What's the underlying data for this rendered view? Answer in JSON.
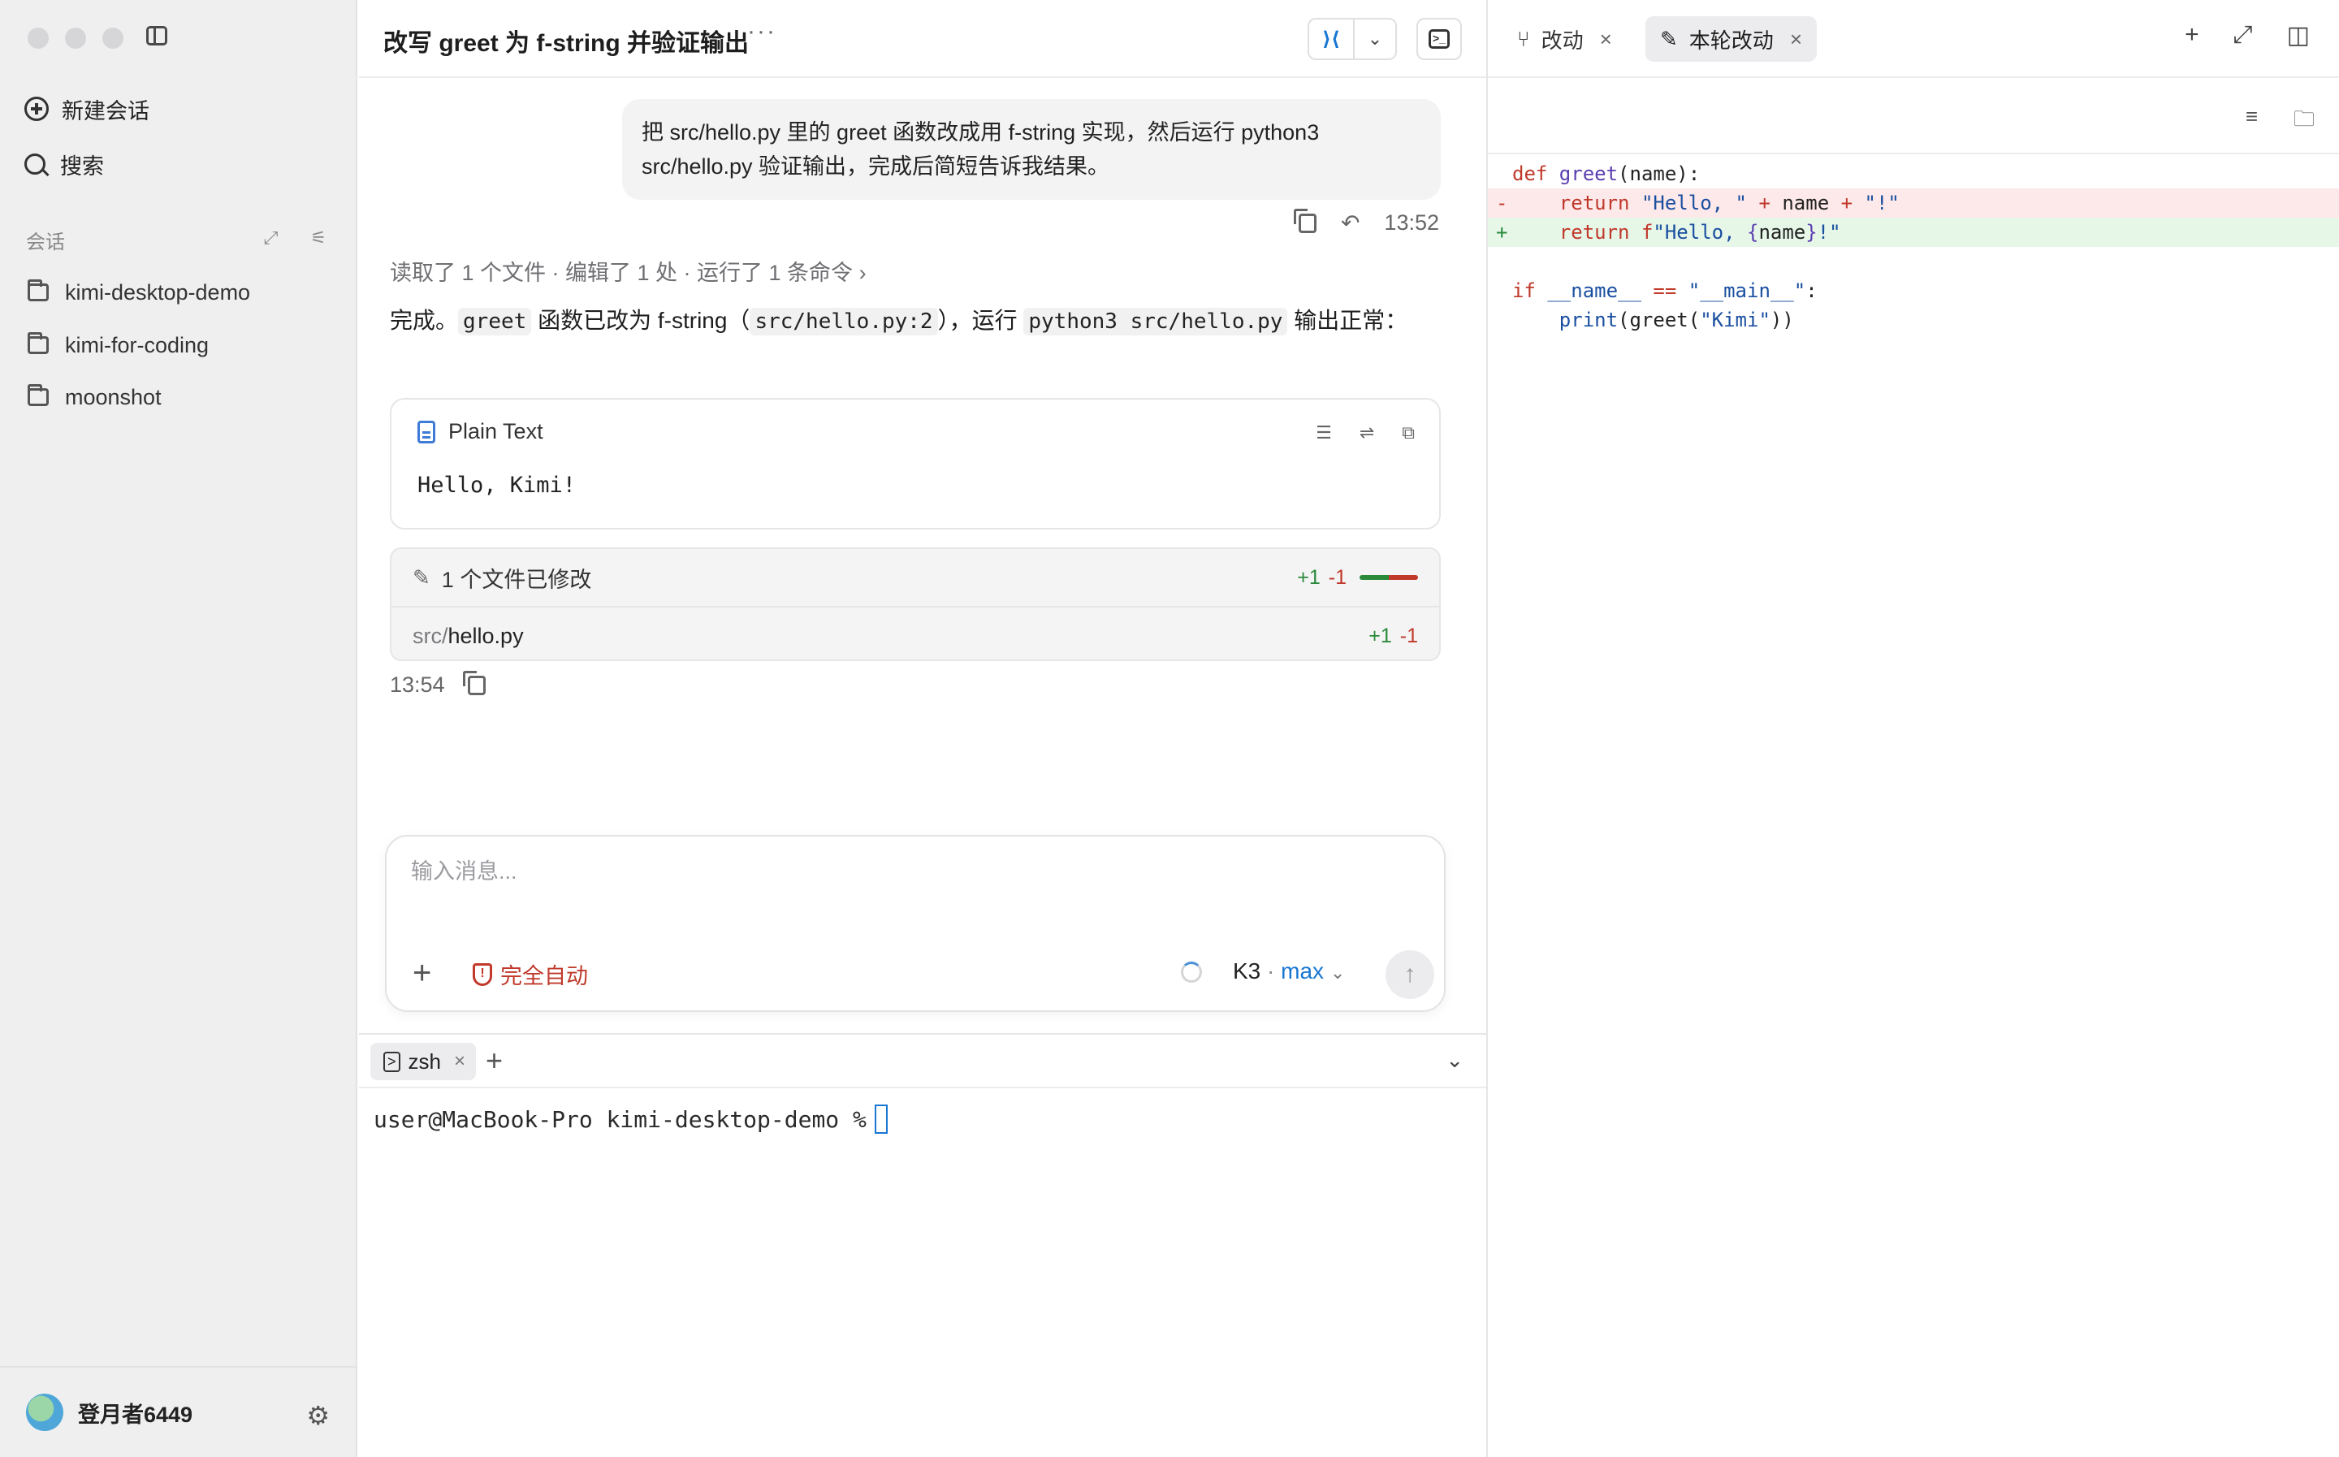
{
  "sidebar": {
    "new_chat": "新建会话",
    "search": "搜索",
    "section_label": "会话",
    "folders": [
      "kimi-desktop-demo",
      "kimi-for-coding",
      "moonshot"
    ],
    "user_name": "登月者6449"
  },
  "header": {
    "title": "改写 greet 为 f-string 并验证输出",
    "more": "···"
  },
  "chat": {
    "user_message": "把 src/hello.py 里的 greet 函数改成用 f-string 实现，然后运行 python3 src/hello.py 验证输出，完成后简短告诉我结果。",
    "user_time": "13:52",
    "activity": "读取了 1 个文件 · 编辑了 1 处 · 运行了 1 条命令",
    "reply": {
      "t1": "完成。",
      "code1": "greet",
      "t2": " 函数已改为 f-string（",
      "code2": "src/hello.py:2",
      "t3": "），运行 ",
      "code3": "python3 src/hello.py",
      "t4": " 输出正常："
    },
    "code_block": {
      "language": "Plain Text",
      "content": "Hello, Kimi!"
    },
    "changes": {
      "title": "1 个文件已修改",
      "additions": "+1",
      "deletions": "-1",
      "file_dir": "src/",
      "file_name": "hello.py",
      "file_additions": "+1",
      "file_deletions": "-1"
    },
    "reply_time": "13:54"
  },
  "composer": {
    "placeholder": "输入消息...",
    "mode": "完全自动",
    "model": "K3",
    "separator": " · ",
    "level": "max"
  },
  "terminal": {
    "tab": "zsh",
    "prompt": "user@MacBook-Pro kimi-desktop-demo %"
  },
  "right_panel": {
    "tabs": [
      {
        "label": "改动"
      },
      {
        "label": "本轮改动"
      }
    ],
    "diff": {
      "l1_kw": "def ",
      "l1_fn": "greet",
      "l1_rest": "(name):",
      "del_kw": "return ",
      "del_s1": "\"Hello, \"",
      "del_op1": " + ",
      "del_mid": "name",
      "del_op2": " + ",
      "del_s2": "\"!\"",
      "add_kw": "return ",
      "add_f": "f",
      "add_s1": "\"Hello, ",
      "add_br1": "{",
      "add_mid": "name",
      "add_br2": "}",
      "add_s2": "!\"",
      "l5_kw": "if ",
      "l5_name": "__name__",
      "l5_op": " == ",
      "l5_str": "\"__main__\"",
      "l5_colon": ":",
      "l6_fn": "print",
      "l6_a": "(greet(",
      "l6_str": "\"Kimi\"",
      "l6_b": "))"
    }
  },
  "colors": {
    "accent_blue": "#1877d2",
    "danger_red": "#c0392b",
    "add_green": "#2a8a3a"
  }
}
